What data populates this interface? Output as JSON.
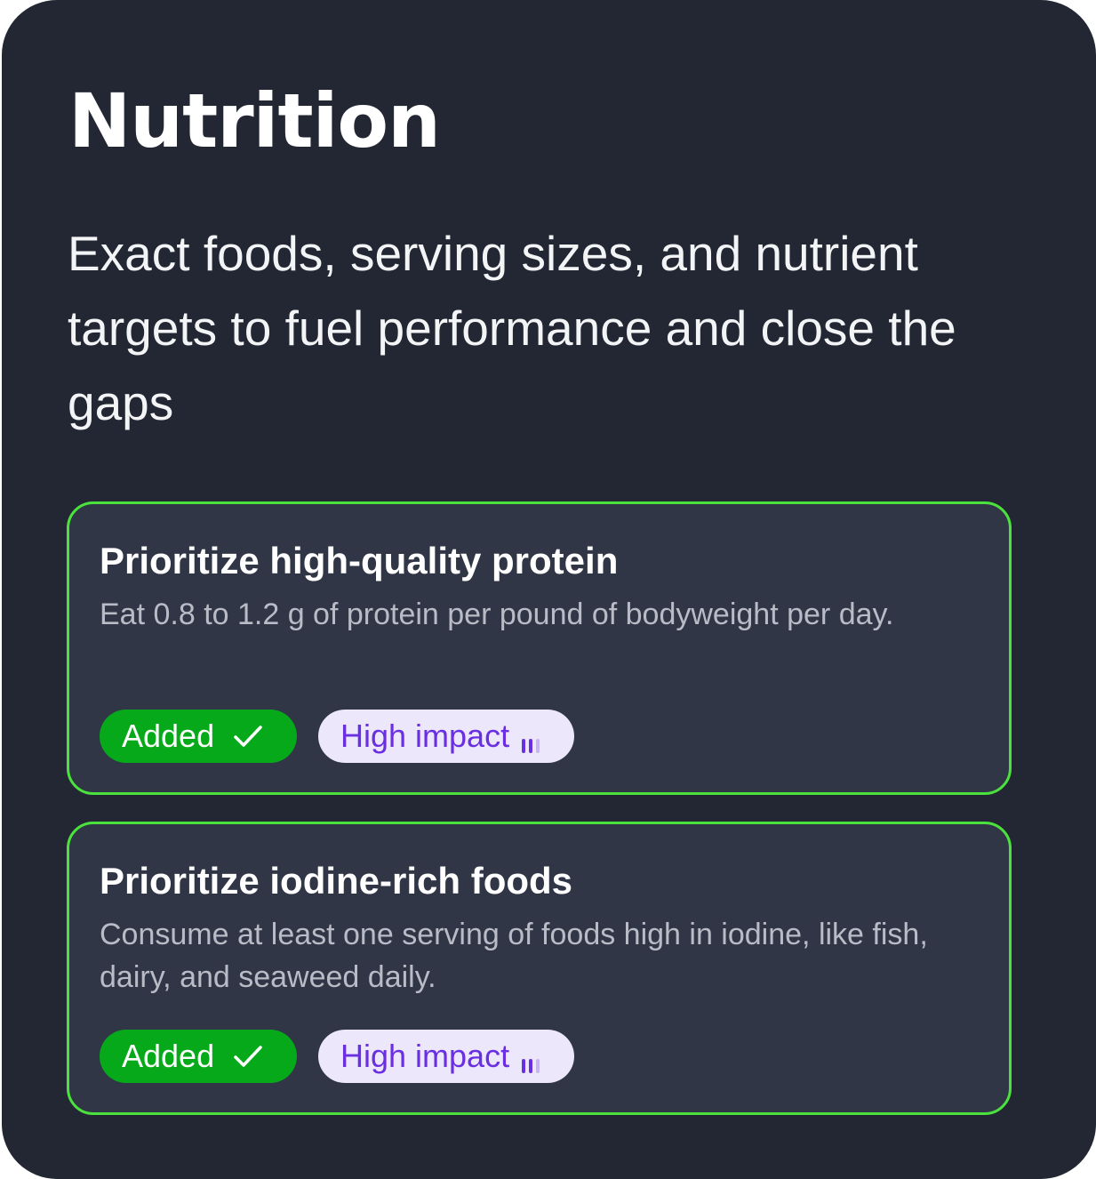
{
  "section": {
    "title": "Nutrition",
    "subtitle": "Exact foods, serving sizes, and nutrient targets to fuel performance and close the gaps"
  },
  "recommendations": [
    {
      "title": "Prioritize high-quality protein",
      "description": "Eat 0.8 to 1.2 g of protein per pound of bodyweight per day.",
      "status_label": "Added",
      "status_icon": "check-icon",
      "impact_label": "High impact",
      "impact_icon": "signal-bars-icon"
    },
    {
      "title": "Prioritize iodine-rich foods",
      "description": "Consume at least one serving of foods high in iodine, like fish, dairy, and seaweed daily.",
      "status_label": "Added",
      "status_icon": "check-icon",
      "impact_label": "High impact",
      "impact_icon": "signal-bars-icon"
    }
  ],
  "colors": {
    "background": "#232733",
    "card": "#303646",
    "card_border": "#4ce23e",
    "added_pill": "#06a91a",
    "impact_pill": "#ece7fb",
    "impact_text": "#6a2fe0"
  }
}
